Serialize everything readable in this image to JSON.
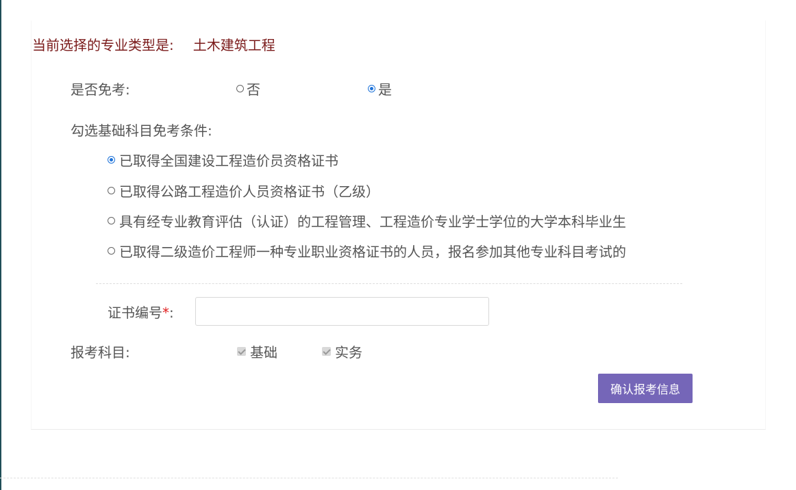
{
  "header": {
    "label": "当前选择的专业类型是:",
    "value": "土木建筑工程"
  },
  "exempt": {
    "label": "是否免考:",
    "options": [
      {
        "label": "否",
        "checked": false
      },
      {
        "label": "是",
        "checked": true
      }
    ]
  },
  "conditions": {
    "label": "勾选基础科目免考条件:",
    "items": [
      {
        "label": "已取得全国建设工程造价员资格证书",
        "checked": true
      },
      {
        "label": "已取得公路工程造价人员资格证书（乙级）",
        "checked": false
      },
      {
        "label": "具有经专业教育评估（认证）的工程管理、工程造价专业学士学位的大学本科毕业生",
        "checked": false
      },
      {
        "label": "已取得二级造价工程师一种专业职业资格证书的人员，报名参加其他专业科目考试的",
        "checked": false
      }
    ]
  },
  "certificate": {
    "label": "证书编号",
    "required_mark": "*",
    "colon": ":",
    "value": "",
    "placeholder": ""
  },
  "subjects": {
    "label": "报考科目:",
    "items": [
      {
        "label": "基础",
        "checked": true,
        "disabled": true
      },
      {
        "label": "实务",
        "checked": true,
        "disabled": true
      }
    ]
  },
  "confirm_button": "确认报考信息",
  "colors": {
    "accent": "#7566b8",
    "radio_selected": "#1e73d9",
    "header_text": "#7a1a1a",
    "required": "#e02020"
  }
}
